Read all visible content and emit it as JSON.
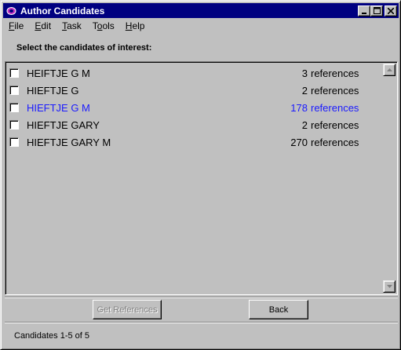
{
  "window": {
    "title": "Author Candidates",
    "icons": {
      "app": "app-logo-icon",
      "minimize": "minimize-icon",
      "maximize": "maximize-icon",
      "close": "close-icon"
    }
  },
  "menu": [
    {
      "label": "File",
      "accel": "F",
      "rest": "ile"
    },
    {
      "label": "Edit",
      "accel": "E",
      "rest": "dit"
    },
    {
      "label": "Task",
      "accel": "T",
      "rest": "ask"
    },
    {
      "label": "Tools",
      "accel": "o",
      "pre": "T",
      "rest": "ols"
    },
    {
      "label": "Help",
      "accel": "H",
      "rest": "elp"
    }
  ],
  "header_label": "Select the candidates of interest:",
  "candidates": [
    {
      "name": "HEIFTJE G M",
      "count": "3",
      "refs_label": "references",
      "checked": false,
      "highlighted": false
    },
    {
      "name": "HIEFTJE G",
      "count": "2",
      "refs_label": "references",
      "checked": false,
      "highlighted": false
    },
    {
      "name": "HIEFTJE G M",
      "count": "178",
      "refs_label": "references",
      "checked": false,
      "highlighted": true
    },
    {
      "name": "HIEFTJE GARY",
      "count": "2",
      "refs_label": "references",
      "checked": false,
      "highlighted": false
    },
    {
      "name": "HIEFTJE GARY M",
      "count": "270",
      "refs_label": "references",
      "checked": false,
      "highlighted": false
    }
  ],
  "buttons": {
    "get_references": "Get References",
    "back": "Back"
  },
  "status": "Candidates 1-5 of 5",
  "colors": {
    "highlight": "#1a1aff",
    "titlebar": "#000080",
    "face": "#c0c0c0"
  }
}
